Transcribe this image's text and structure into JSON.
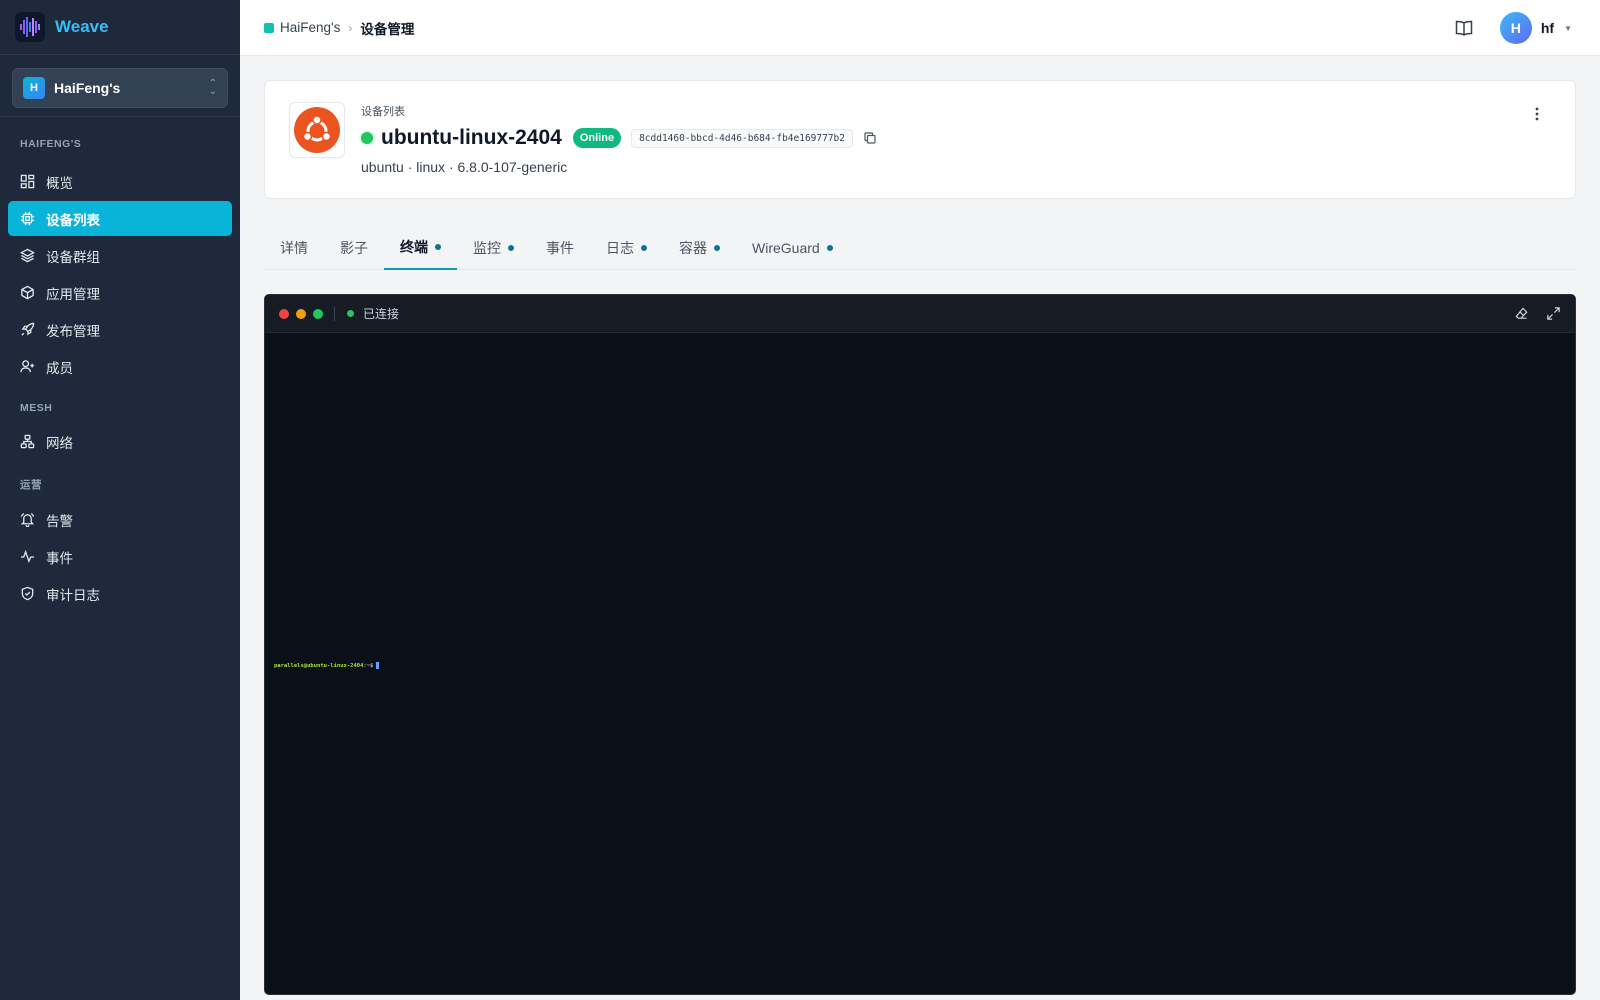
{
  "app": {
    "name": "Weave"
  },
  "org_switcher": {
    "initial": "H",
    "name": "HaiFeng's"
  },
  "sidebar": {
    "sections": [
      {
        "title": "HAIFENG'S"
      },
      {
        "title": "MESH"
      },
      {
        "title": "运营"
      }
    ],
    "items": [
      {
        "label": "概览",
        "icon": "dashboard-icon"
      },
      {
        "label": "设备列表",
        "icon": "chip-icon",
        "active": true
      },
      {
        "label": "设备群组",
        "icon": "layers-icon"
      },
      {
        "label": "应用管理",
        "icon": "package-icon"
      },
      {
        "label": "发布管理",
        "icon": "rocket-icon"
      },
      {
        "label": "成员",
        "icon": "user-plus-icon"
      },
      {
        "label": "网络",
        "icon": "network-icon"
      },
      {
        "label": "告警",
        "icon": "bell-icon"
      },
      {
        "label": "事件",
        "icon": "activity-icon"
      },
      {
        "label": "审计日志",
        "icon": "shield-icon"
      }
    ]
  },
  "topbar": {
    "breadcrumb": {
      "org": "HaiFeng's",
      "current": "设备管理"
    },
    "user": {
      "initial": "H",
      "name": "hf"
    }
  },
  "device": {
    "breadcrumb": "设备列表",
    "name": "ubuntu-linux-2404",
    "status": "Online",
    "id": "8cdd1460-bbcd-4d46-b684-fb4e169777b2",
    "meta": "ubuntu · linux · 6.8.0-107-generic",
    "os_icon": "ubuntu-icon",
    "status_color": "#22c55e"
  },
  "tabs": [
    {
      "label": "详情",
      "dot": false
    },
    {
      "label": "影子",
      "dot": false
    },
    {
      "label": "终端",
      "dot": true,
      "active": true
    },
    {
      "label": "监控",
      "dot": true
    },
    {
      "label": "事件",
      "dot": false
    },
    {
      "label": "日志",
      "dot": true
    },
    {
      "label": "容器",
      "dot": true
    },
    {
      "label": "WireGuard",
      "dot": true
    }
  ],
  "terminal": {
    "status": "已连接",
    "prompt_user": "parallels@ubuntu-linux-2404",
    "prompt_suffix": ":~$"
  },
  "colors": {
    "accent": "#0ab4d9",
    "sidebar_bg": "#1e293b",
    "online": "#10b981",
    "ubuntu_orange": "#e95420"
  }
}
